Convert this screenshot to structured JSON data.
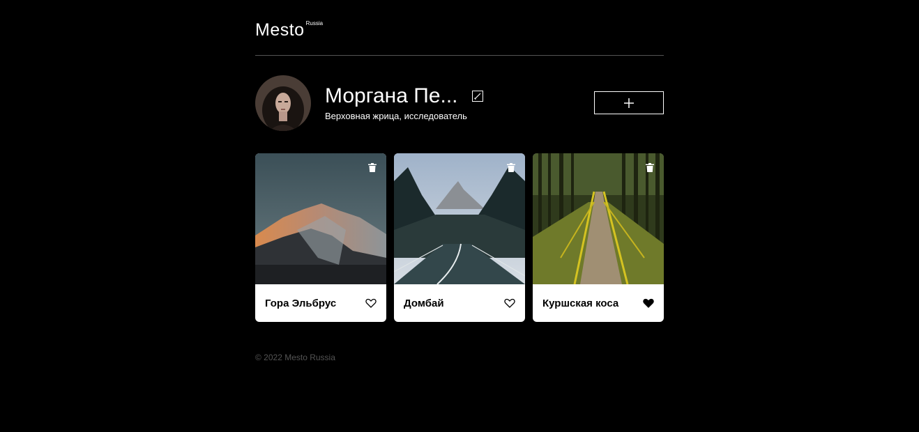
{
  "header": {
    "logo": "Mesto",
    "logo_sup": "Russia"
  },
  "profile": {
    "name": "Моргана Пе...",
    "about": "Верховная жрица, исследователь",
    "edit_icon": "pencil-icon",
    "add_icon": "plus-icon"
  },
  "cards": [
    {
      "title": "Гора Эльбрус",
      "liked": false,
      "image": "mountain-sunset"
    },
    {
      "title": "Домбай",
      "liked": false,
      "image": "mountain-road"
    },
    {
      "title": "Куршская коса",
      "liked": true,
      "image": "forest-boardwalk"
    }
  ],
  "footer": {
    "copyright": "© 2022 Mesto Russia"
  },
  "colors": {
    "background": "#000000",
    "card": "#ffffff",
    "divider": "#545454",
    "footer_text": "#545454"
  }
}
